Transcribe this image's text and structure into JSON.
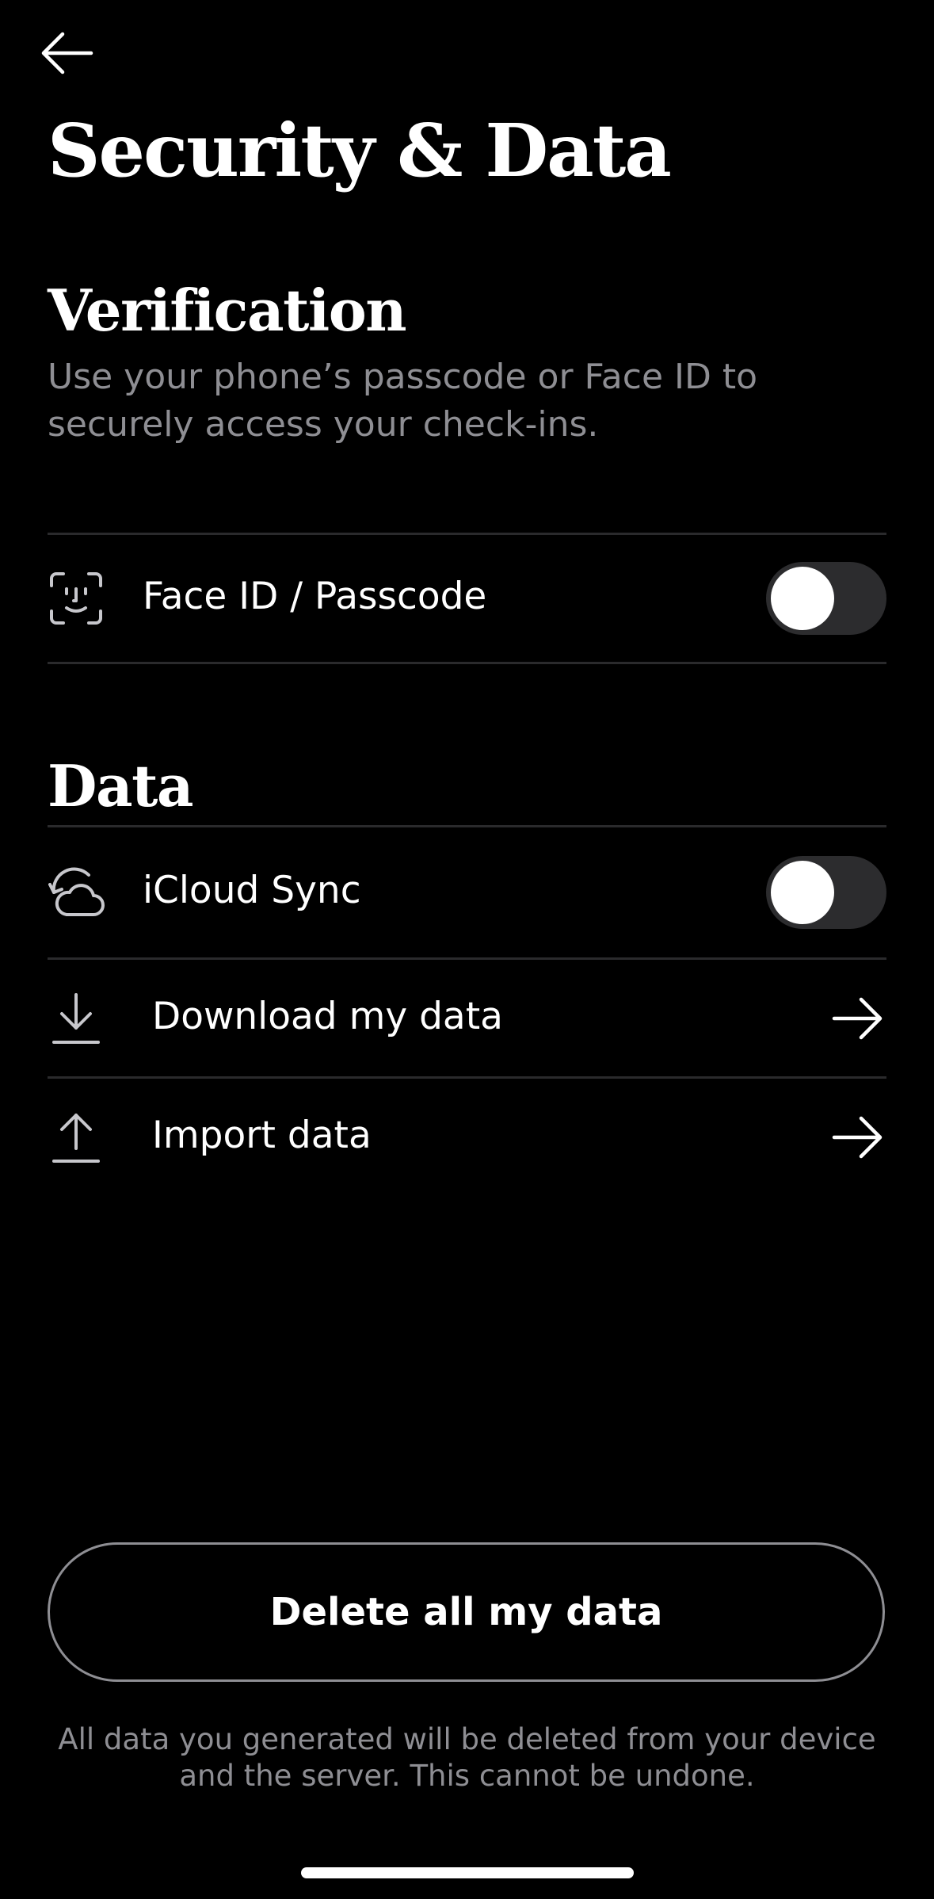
{
  "header": {
    "back_icon": "arrow-left-icon",
    "title": "Security & Data"
  },
  "verification": {
    "title": "Verification",
    "description": "Use your phone’s passcode or Face ID to securely access your check-ins.",
    "items": [
      {
        "icon": "face-id-icon",
        "label": "Face ID / Passcode",
        "control": "toggle",
        "enabled": false
      }
    ]
  },
  "data_section": {
    "title": "Data",
    "items": [
      {
        "icon": "cloud-sync-icon",
        "label": "iCloud Sync",
        "control": "toggle",
        "enabled": false
      },
      {
        "icon": "download-icon",
        "label": "Download my data",
        "control": "arrow",
        "control_icon": "arrow-right-icon"
      },
      {
        "icon": "upload-icon",
        "label": "Import data",
        "control": "arrow",
        "control_icon": "arrow-right-icon"
      }
    ]
  },
  "danger": {
    "delete_label": "Delete all my data",
    "footnote": "All data you generated will be deleted from your device and the server. This cannot be undone."
  },
  "colors": {
    "background": "#000000",
    "text": "#ffffff",
    "secondary_text": "#8e8e93",
    "divider": "#2a2a2c",
    "toggle_track": "#2c2c2e",
    "toggle_knob": "#ffffff",
    "button_border": "#8e8e93"
  }
}
